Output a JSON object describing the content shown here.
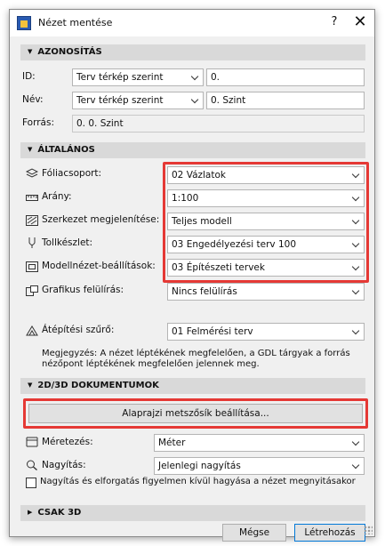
{
  "window": {
    "title": "Nézet mentése",
    "help": "?",
    "close": "✕"
  },
  "sections": {
    "azonositas": "AZONOSÍTÁS",
    "altalanos": "ÁLTALÁNOS",
    "dokumentumok": "2D/3D DOKUMENTUMOK",
    "csak3d": "CSAK 3D"
  },
  "identification": {
    "id_label": "ID:",
    "id_select": "Terv térkép szerint",
    "id_value": "0.",
    "nev_label": "Név:",
    "nev_select": "Terv térkép szerint",
    "nev_value": "0. Szint",
    "forras_label": "Forrás:",
    "forras_value": "0. 0. Szint"
  },
  "general": {
    "rows": [
      {
        "label": "Fóliacsoport:",
        "value": "02 Vázlatok",
        "icon": "layers-icon"
      },
      {
        "label": "Arány:",
        "value": "1:100",
        "icon": "ruler-icon"
      },
      {
        "label": "Szerkezet megjelenítése:",
        "value": "Teljes modell",
        "icon": "structure-icon"
      },
      {
        "label": "Tollkészlet:",
        "value": "03 Engedélyezési terv 100",
        "icon": "pen-icon"
      },
      {
        "label": "Modellnézet-beállítások:",
        "value": "03 Építészeti tervek",
        "icon": "model-view-icon"
      },
      {
        "label": "Grafikus felülírás:",
        "value": "Nincs felülírás",
        "icon": "graphic-override-icon"
      },
      {
        "label": "Átépítési szűrő:",
        "value": "01 Felmérési terv",
        "icon": "renovation-icon"
      }
    ],
    "note": "Megjegyzés: A nézet léptékének megfelelően, a GDL tárgyak a forrás nézőpont léptékének megfelelően jelennek meg."
  },
  "documents": {
    "floor_plan_button": "Alaprajzi metszősík beállítása...",
    "meretezes_label": "Méretezés:",
    "meretezes_value": "Méter",
    "nagyitas_label": "Nagyítás:",
    "nagyitas_value": "Jelenlegi nagyítás",
    "checkbox_label": "Nagyítás és elforgatás figyelmen kívül hagyása a nézet megnyitásakor",
    "checkbox_checked": false
  },
  "buttons": {
    "cancel": "Mégse",
    "create": "Létrehozás"
  },
  "colors": {
    "highlight": "#e53935",
    "section_bg": "#d9d9d9",
    "dialog_bg": "#f0f0f0"
  }
}
